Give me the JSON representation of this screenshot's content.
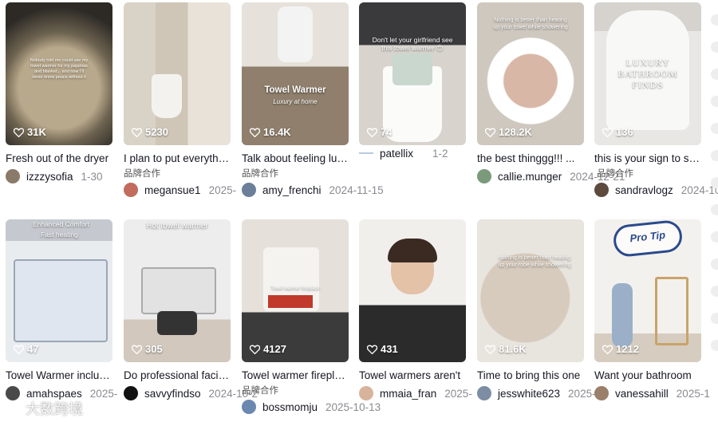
{
  "cards": [
    {
      "views": "31K",
      "overlay": "Nobody told me could use my towel warmer for my pajamas and blanket... and now I'll never know peace without it",
      "title": "Fresh out of the dryer",
      "tag": "",
      "user": "izzzysofia",
      "date": "1-30"
    },
    {
      "views": "5230",
      "overlay": "",
      "title": "I plan to put everything",
      "tag": "品牌合作",
      "user": "megansue1",
      "date": "2025-"
    },
    {
      "views": "16.4K",
      "overlay": "Towel Warmer",
      "overlay2": "Luxury at home",
      "title": "Talk about feeling luxury",
      "tag": "品牌合作",
      "user": "amy_frenchi",
      "date": "2024-11-15"
    },
    {
      "views": "74",
      "overlay": "Don't let your girlfriend see this towel warmer 😍",
      "title": "",
      "tag": "",
      "user": "patellix",
      "date": "1-2"
    },
    {
      "views": "128.2K",
      "overlay": "Nothing is better than heating up your towel while showering",
      "title": "the best thinggg!!! ...",
      "tag": "",
      "user": "callie.munger",
      "date": "2024-12-21"
    },
    {
      "views": "136",
      "overlay": "LUXURY BATHROOM FINDS",
      "title": "this is your sign to splurge",
      "tag": "品牌合作",
      "user": "sandravlogz",
      "date": "2024-10"
    },
    {
      "views": "47",
      "overlay": "Enhanced Comfort",
      "overlay2": "Fast heating",
      "title": "Towel Warmer includes",
      "tag": "",
      "user": "amahspaes",
      "date": "2025-"
    },
    {
      "views": "305",
      "overlay": "Hot towel warmer",
      "title": "Do professional facials",
      "tag": "",
      "user": "savvyfindso",
      "date": "2024-10-2"
    },
    {
      "views": "4127",
      "overlay": "Towel warmer fireplace",
      "title": "Towel warmer fireplace",
      "tag": "品牌合作",
      "user": "bossmomju",
      "date": "2025-10-13"
    },
    {
      "views": "431",
      "overlay": "",
      "title": "Towel warmers aren't",
      "tag": "",
      "user": "mmaia_fran",
      "date": "2025-"
    },
    {
      "views": "81.6K",
      "overlay": "nothing is better than heating up your robe while showering",
      "title": "Time to bring this one",
      "tag": "",
      "user": "jesswhite623",
      "date": "2025-"
    },
    {
      "views": "1212",
      "overlay": "Pro Tip",
      "title": "Want your bathroom",
      "tag": "",
      "user": "vanessahill",
      "date": "2025-1"
    }
  ],
  "watermark": "大数跨境",
  "colors": {
    "accent": "#fe2c55",
    "text": "#161823",
    "muted": "#8a8b91"
  }
}
